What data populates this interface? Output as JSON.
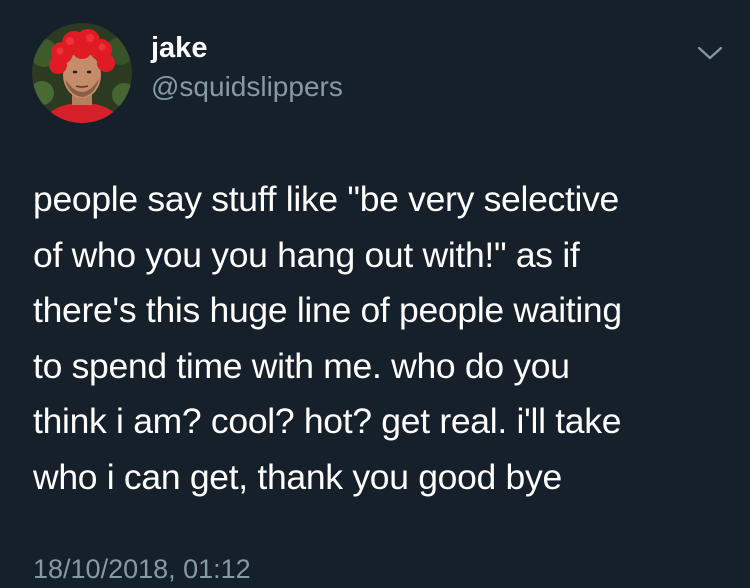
{
  "author": {
    "display_name": "jake",
    "handle": "@squidslippers",
    "avatar_icon": "profile-photo-red-wig"
  },
  "menu": {
    "icon": "chevron-down-icon"
  },
  "tweet": {
    "lines": [
      "people say stuff like \"be very selective",
      "of who you you hang out with!\" as if",
      "there's this huge line of people waiting",
      "to spend time with me. who do you",
      "think i am? cool? hot? get real. i'll take",
      "who i can get, thank you good bye"
    ],
    "timestamp": "18/10/2018, 01:12"
  },
  "colors": {
    "background": "#15202b",
    "primary_text": "#ffffff",
    "secondary_text": "#8899a6"
  }
}
